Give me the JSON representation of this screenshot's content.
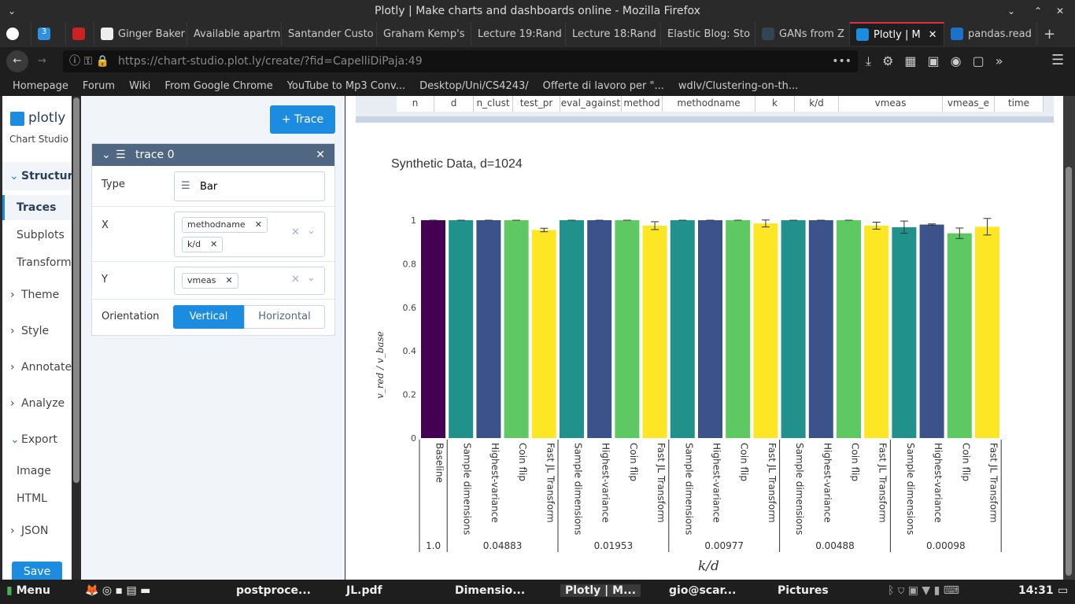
{
  "window": {
    "title": "Plotly | Make charts and dashboards online - Mozilla Firefox"
  },
  "tabs": [
    {
      "label": "3"
    },
    {
      "label": "Ginger Baker"
    },
    {
      "label": "Available apartm"
    },
    {
      "label": "Santander Custo"
    },
    {
      "label": "Graham Kemp's"
    },
    {
      "label": "Lecture 19:Rand"
    },
    {
      "label": "Lecture 18:Rand"
    },
    {
      "label": "Elastic Blog: Sto"
    },
    {
      "label": "GANs from Z"
    },
    {
      "label": "Plotly | M"
    },
    {
      "label": "pandas.read"
    }
  ],
  "url": "https://chart-studio.plot.ly/create/?fid=CapelliDiPaja:49",
  "bookmarks": [
    "Homepage",
    "Forum",
    "Wiki",
    "From Google Chrome",
    "YouTube to Mp3 Conv...",
    "Desktop/Uni/CS4243/",
    "Offerte di lavoro per \"...",
    "wdlv/Clustering-on-th..."
  ],
  "sidebar": {
    "brand": "plotly",
    "sub": "Chart Studio",
    "items": [
      "Structure",
      "Traces",
      "Subplots",
      "Transform",
      "Theme",
      "Style",
      "Annotate",
      "Analyze",
      "Export",
      "Image",
      "HTML",
      "JSON"
    ],
    "save": "Save"
  },
  "panel": {
    "add_trace": "+ Trace",
    "trace_name": "trace 0",
    "type_label": "Type",
    "type_value": "Bar",
    "x_label": "X",
    "x_chips": [
      "methodname",
      "k/d"
    ],
    "y_label": "Y",
    "y_chips": [
      "vmeas"
    ],
    "orient_label": "Orientation",
    "vertical": "Vertical",
    "horizontal": "Horizontal"
  },
  "grid_cols": [
    "n",
    "d",
    "n_clust",
    "test_pr",
    "eval_against",
    "method",
    "methodname",
    "k",
    "k/d",
    "vmeas",
    "vmeas_e",
    "time"
  ],
  "chart_data": {
    "type": "bar",
    "title": "Synthetic Data, d=1024",
    "ylabel": "v_red / v_base",
    "xlabel": "k/d",
    "ylim": [
      0,
      1
    ],
    "yticks": [
      "0",
      "0.2",
      "0.4",
      "0.6",
      "0.8",
      "1"
    ],
    "groups": [
      "1.0",
      "0.04883",
      "0.01953",
      "0.00977",
      "0.00488",
      "0.00098"
    ],
    "categories": [
      "Baseline",
      "Sample dimensions",
      "Highest-variance",
      "Coin flip",
      "Fast JL Transform",
      "Sample dimensions",
      "Highest-variance",
      "Coin flip",
      "Fast JL Transform",
      "Sample dimensions",
      "Highest-variance",
      "Coin flip",
      "Fast JL Transform",
      "Sample dimensions",
      "Highest-variance",
      "Coin flip",
      "Fast JL Transform",
      "Sample dimensions",
      "Highest-variance",
      "Coin flip",
      "Fast JL Transform"
    ],
    "values": [
      1,
      1,
      1,
      1,
      0.955,
      1,
      1,
      1,
      0.975,
      1,
      1,
      1,
      0.985,
      1,
      1,
      1,
      0.975,
      0.968,
      0.98,
      0.94,
      0.97
    ],
    "errors": [
      0,
      0,
      0,
      0,
      0.008,
      0,
      0,
      0,
      0.018,
      0,
      0,
      0,
      0.016,
      0,
      0,
      0,
      0.016,
      0.028,
      0.003,
      0.024,
      0.038
    ],
    "colors": {
      "baseline": "#440154",
      "sample": "#21918c",
      "highest": "#3b528b",
      "coin": "#5ec962",
      "fast": "#fde725"
    }
  },
  "taskbar": {
    "menu": "Menu",
    "items": [
      "postproce...",
      "JL.pdf",
      "Dimensio...",
      "Plotly | M...",
      "gio@scar...",
      "Pictures"
    ],
    "time": "14:31"
  }
}
